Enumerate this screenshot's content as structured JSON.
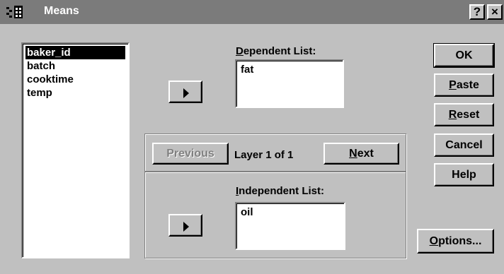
{
  "window": {
    "title": "Means",
    "help_button": "?",
    "close_button": "×"
  },
  "variables": {
    "items": [
      {
        "label": "baker_id",
        "selected": true
      },
      {
        "label": "batch",
        "selected": false
      },
      {
        "label": "cooktime",
        "selected": false
      },
      {
        "label": "temp",
        "selected": false
      }
    ]
  },
  "dependent": {
    "label_key": "D",
    "label_rest": "ependent List:",
    "items": [
      "fat"
    ]
  },
  "layer": {
    "previous_label": "Previous",
    "previous_enabled": false,
    "status": "Layer 1 of 1",
    "next_key": "N",
    "next_rest": "ext"
  },
  "independent": {
    "label_key": "I",
    "label_rest": "ndependent List:",
    "items": [
      "oil"
    ]
  },
  "buttons": {
    "ok": "OK",
    "paste_key": "P",
    "paste_rest": "aste",
    "reset_key": "R",
    "reset_rest": "eset",
    "cancel": "Cancel",
    "help": "Help",
    "options_key": "O",
    "options_rest": "ptions..."
  }
}
